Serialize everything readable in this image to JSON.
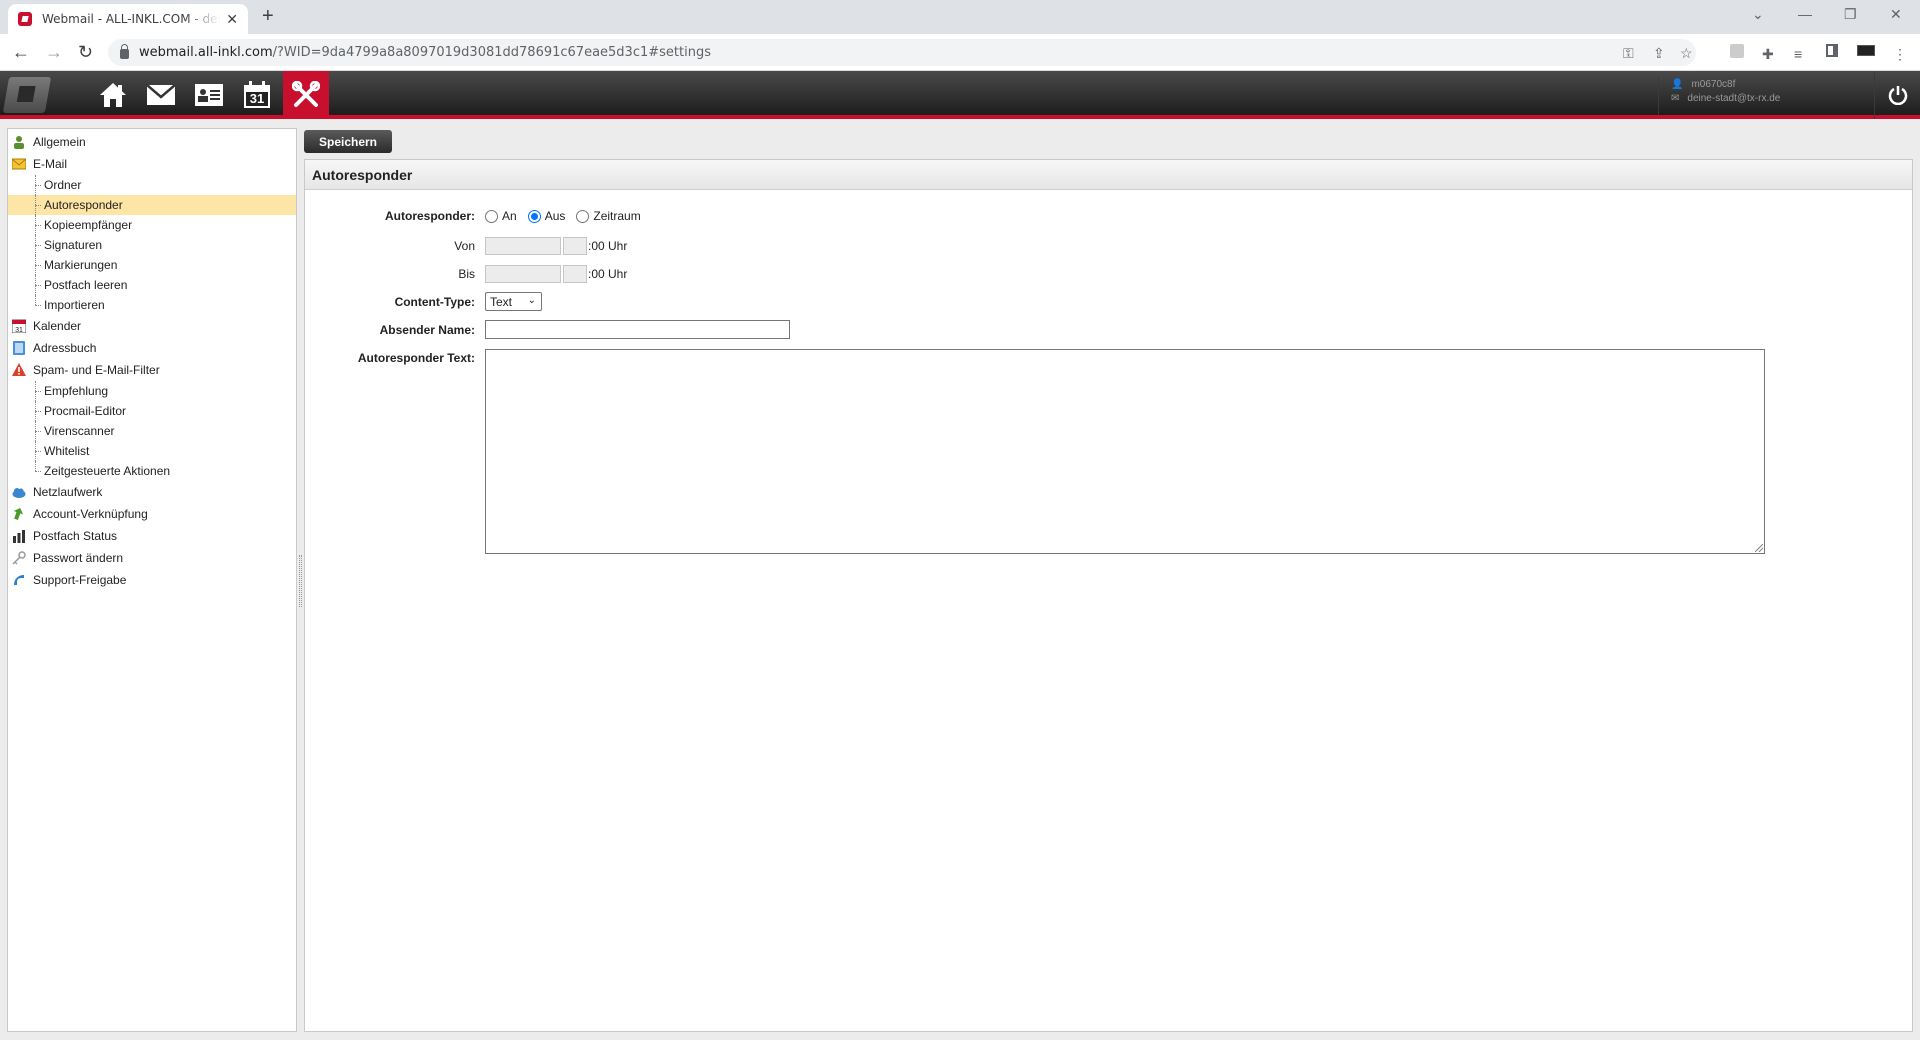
{
  "browser": {
    "tab_title": "Webmail - ALL-INKL.COM - deine-stadt@tx-rx.de",
    "url_host": "webmail.all-inkl.com",
    "url_rest": "/?WID=9da4799a8a8097019d3081dd78691c67eae5d3c1#settings"
  },
  "header": {
    "username": "m0670c8f",
    "email": "deine-stadt@tx-rx.de",
    "calendar_day": "31"
  },
  "sidebar": {
    "allgemein": "Allgemein",
    "email": "E-Mail",
    "email_sub": [
      "Ordner",
      "Autoresponder",
      "Kopieempfänger",
      "Signaturen",
      "Markierungen",
      "Postfach leeren",
      "Importieren"
    ],
    "kalender": "Kalender",
    "adressbuch": "Adressbuch",
    "spam": "Spam- und E-Mail-Filter",
    "spam_sub": [
      "Empfehlung",
      "Procmail-Editor",
      "Virenscanner",
      "Whitelist",
      "Zeitgesteuerte Aktionen"
    ],
    "netzlaufwerk": "Netzlaufwerk",
    "account": "Account-Verknüpfung",
    "postfach_status": "Postfach Status",
    "passwort": "Passwort ändern",
    "support": "Support-Freigabe"
  },
  "toolbar": {
    "save_label": "Speichern"
  },
  "panel": {
    "title": "Autoresponder",
    "autoresponder_label": "Autoresponder:",
    "radio_on": "An",
    "radio_off": "Aus",
    "radio_period": "Zeitraum",
    "selected": "Aus",
    "von_label": "Von",
    "bis_label": "Bis",
    "uhr_suffix": ":00 Uhr",
    "content_type_label": "Content-Type:",
    "content_type_value": "Text",
    "sender_label": "Absender Name:",
    "sender_value": "",
    "text_label": "Autoresponder Text:",
    "text_value": ""
  },
  "colors": {
    "accent": "#c8102e",
    "selected_row": "#fde5a6",
    "radio_checked": "#0075ff"
  }
}
